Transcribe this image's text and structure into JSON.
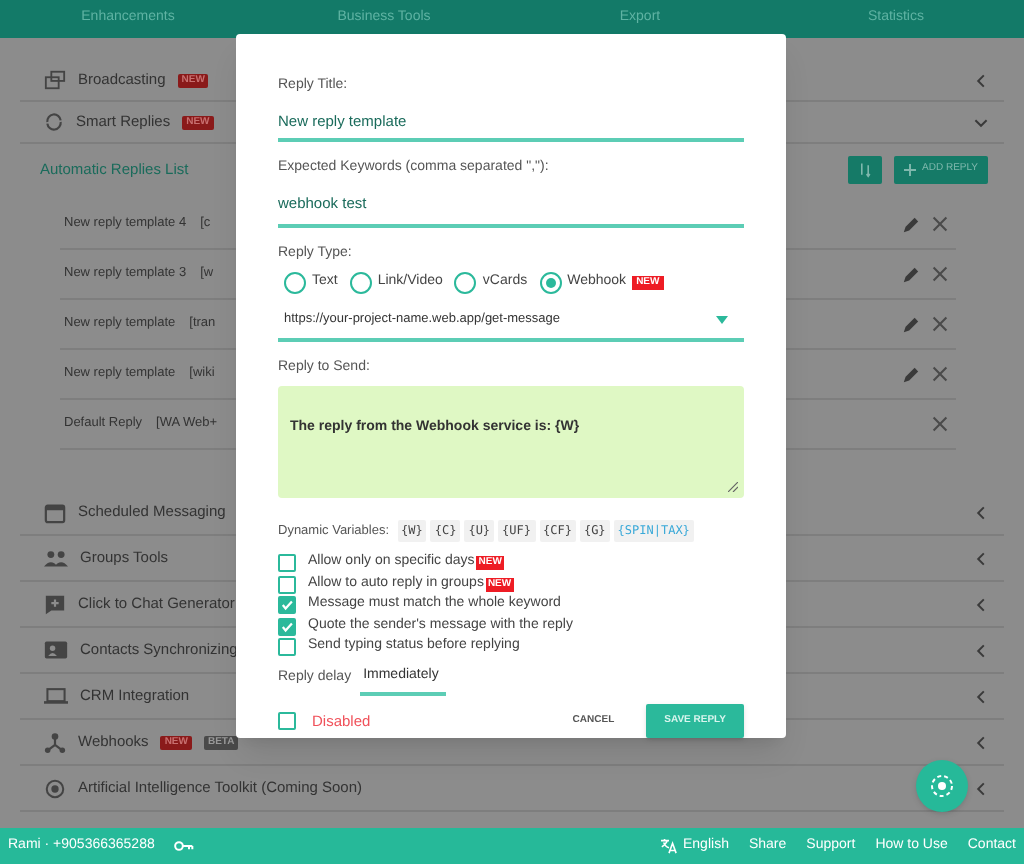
{
  "top_tabs": [
    "Enhancements",
    "Business Tools",
    "Export",
    "Statistics"
  ],
  "sections": [
    {
      "label": "Broadcasting",
      "badges": [
        {
          "text": "NEW",
          "kind": "new"
        }
      ],
      "expanded": false
    },
    {
      "label": "Smart Replies",
      "badges": [
        {
          "text": "NEW",
          "kind": "new"
        }
      ],
      "expanded": true
    }
  ],
  "replies_list": {
    "title": "Automatic Replies List",
    "add_button": "ADD REPLY",
    "rows": [
      {
        "title": "New reply template 4",
        "keyword": "[c",
        "editable": true
      },
      {
        "title": "New reply template 3",
        "keyword": "[w",
        "editable": true
      },
      {
        "title": "New reply template",
        "keyword": "[tran",
        "editable": true
      },
      {
        "title": "New reply template",
        "keyword": "[wiki",
        "editable": true
      },
      {
        "title": "Default Reply",
        "keyword": "[WA Web+",
        "editable": false
      }
    ]
  },
  "tools": [
    {
      "label": "Scheduled Messaging"
    },
    {
      "label": "Groups Tools"
    },
    {
      "label": "Click to Chat Generator"
    },
    {
      "label": "Contacts Synchronizing"
    },
    {
      "label": "CRM Integration"
    },
    {
      "label": "Webhooks",
      "badges": [
        {
          "text": "NEW",
          "kind": "new"
        },
        {
          "text": "BETA",
          "kind": "beta"
        }
      ]
    },
    {
      "label": "Artificial Intelligence Toolkit (Coming Soon)"
    }
  ],
  "modal": {
    "title_field": {
      "label": "Reply Title:",
      "value": "New reply template"
    },
    "keywords_field": {
      "label": "Expected Keywords (comma separated \",\"):",
      "value": "webhook test"
    },
    "reply_type": {
      "label": "Reply Type:",
      "options": [
        {
          "label": "Text",
          "selected": false
        },
        {
          "label": "Link/Video",
          "selected": false
        },
        {
          "label": "vCards",
          "selected": false
        },
        {
          "label": "Webhook",
          "selected": true,
          "badge": "NEW"
        }
      ]
    },
    "webhook_url": "https://your-project-name.web.app/get-message",
    "reply_to_send": {
      "label": "Reply to Send:",
      "value": "The reply from the Webhook service is: {W}"
    },
    "dynamic_variables": {
      "label": "Dynamic Variables:",
      "vars": [
        {
          "text": "{W}",
          "kind": "plain"
        },
        {
          "text": "{C}",
          "kind": "plain"
        },
        {
          "text": "{U}",
          "kind": "plain"
        },
        {
          "text": "{UF}",
          "kind": "plain"
        },
        {
          "text": "{CF}",
          "kind": "plain"
        },
        {
          "text": "{G}",
          "kind": "plain"
        },
        {
          "text": "{SPIN|TAX}",
          "kind": "spin"
        }
      ]
    },
    "options": [
      {
        "label": "Allow only on specific days",
        "checked": false,
        "badge": "NEW"
      },
      {
        "label": "Allow to auto reply in groups",
        "checked": false,
        "badge": "NEW"
      },
      {
        "label": "Message must match the whole keyword",
        "checked": true
      },
      {
        "label": "Quote the sender's message with the reply",
        "checked": true
      },
      {
        "label": "Send typing status before replying",
        "checked": false
      }
    ],
    "reply_delay": {
      "label": "Reply delay",
      "value": "Immediately"
    },
    "disabled": {
      "label": "Disabled",
      "checked": false
    },
    "cancel": "CANCEL",
    "save": "SAVE REPLY"
  },
  "footer": {
    "user": "Rami · +905366365288",
    "links": [
      "English",
      "Share",
      "Support",
      "How to Use",
      "Contact"
    ]
  }
}
